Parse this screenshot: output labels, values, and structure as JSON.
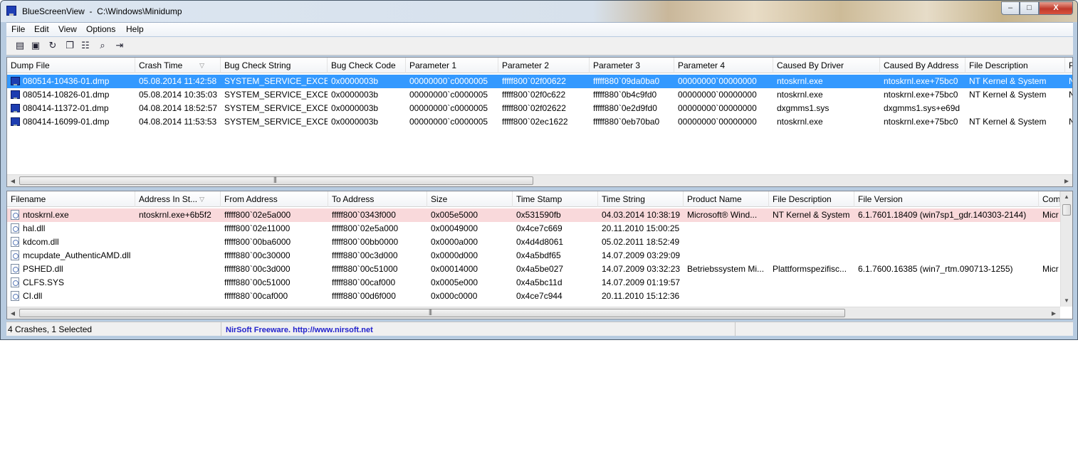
{
  "window": {
    "title": "BlueScreenView  -  C:\\Windows\\Minidump"
  },
  "titlebar_buttons": {
    "minimize": "–",
    "maximize": "□",
    "close": "X"
  },
  "menu": [
    "File",
    "Edit",
    "View",
    "Options",
    "Help"
  ],
  "toolbar": [
    {
      "icon": "properties-icon",
      "glyph": "▤"
    },
    {
      "icon": "save-icon",
      "glyph": "▣"
    },
    {
      "icon": "refresh-icon",
      "glyph": "↻"
    },
    {
      "icon": "copy-icon",
      "glyph": "❐"
    },
    {
      "icon": "report-icon",
      "glyph": "☷"
    },
    {
      "icon": "find-icon",
      "glyph": "⌕"
    },
    {
      "icon": "exit-icon",
      "glyph": "⇥"
    }
  ],
  "dumps": {
    "columns": [
      "Dump File",
      "Crash Time",
      "Bug Check String",
      "Bug Check Code",
      "Parameter 1",
      "Parameter 2",
      "Parameter 3",
      "Parameter 4",
      "Caused By Driver",
      "Caused By Address",
      "File Description",
      "P"
    ],
    "sorted_column": "Crash Time",
    "rows": [
      [
        "080514-10436-01.dmp",
        "05.08.2014 11:42:58",
        "SYSTEM_SERVICE_EXCE...",
        "0x0000003b",
        "00000000`c0000005",
        "fffff800`02f00622",
        "fffff880`09da0ba0",
        "00000000`00000000",
        "ntoskrnl.exe",
        "ntoskrnl.exe+75bc0",
        "NT Kernel & System",
        "N"
      ],
      [
        "080514-10826-01.dmp",
        "05.08.2014 10:35:03",
        "SYSTEM_SERVICE_EXCE...",
        "0x0000003b",
        "00000000`c0000005",
        "fffff800`02f0c622",
        "fffff880`0b4c9fd0",
        "00000000`00000000",
        "ntoskrnl.exe",
        "ntoskrnl.exe+75bc0",
        "NT Kernel & System",
        "N"
      ],
      [
        "080414-11372-01.dmp",
        "04.08.2014 18:52:57",
        "SYSTEM_SERVICE_EXCE...",
        "0x0000003b",
        "00000000`c0000005",
        "fffff800`02f02622",
        "fffff880`0e2d9fd0",
        "00000000`00000000",
        "dxgmms1.sys",
        "dxgmms1.sys+e69d",
        "",
        ""
      ],
      [
        "080414-16099-01.dmp",
        "04.08.2014 11:53:53",
        "SYSTEM_SERVICE_EXCE...",
        "0x0000003b",
        "00000000`c0000005",
        "fffff800`02ec1622",
        "fffff880`0eb70ba0",
        "00000000`00000000",
        "ntoskrnl.exe",
        "ntoskrnl.exe+75bc0",
        "NT Kernel & System",
        "N"
      ]
    ],
    "selected_index": 0
  },
  "modules": {
    "columns": [
      "Filename",
      "Address In St...",
      "From Address",
      "To Address",
      "Size",
      "Time Stamp",
      "Time String",
      "Product Name",
      "File Description",
      "File Version",
      "Com"
    ],
    "sorted_column": "Address In St...",
    "rows": [
      [
        "ntoskrnl.exe",
        "ntoskrnl.exe+6b5f2",
        "fffff800`02e5a000",
        "fffff800`0343f000",
        "0x005e5000",
        "0x531590fb",
        "04.03.2014 10:38:19",
        "Microsoft® Wind...",
        "NT Kernel & System",
        "6.1.7601.18409 (win7sp1_gdr.140303-2144)",
        "Micr"
      ],
      [
        "hal.dll",
        "",
        "fffff800`02e11000",
        "fffff800`02e5a000",
        "0x00049000",
        "0x4ce7c669",
        "20.11.2010 15:00:25",
        "",
        "",
        "",
        ""
      ],
      [
        "kdcom.dll",
        "",
        "fffff800`00ba6000",
        "fffff800`00bb0000",
        "0x0000a000",
        "0x4d4d8061",
        "05.02.2011 18:52:49",
        "",
        "",
        "",
        ""
      ],
      [
        "mcupdate_AuthenticAMD.dll",
        "",
        "fffff880`00c30000",
        "fffff880`00c3d000",
        "0x0000d000",
        "0x4a5bdf65",
        "14.07.2009 03:29:09",
        "",
        "",
        "",
        ""
      ],
      [
        "PSHED.dll",
        "",
        "fffff880`00c3d000",
        "fffff880`00c51000",
        "0x00014000",
        "0x4a5be027",
        "14.07.2009 03:32:23",
        "Betriebssystem Mi...",
        "Plattformspezifisc...",
        "6.1.7600.16385 (win7_rtm.090713-1255)",
        "Micr"
      ],
      [
        "CLFS.SYS",
        "",
        "fffff880`00c51000",
        "fffff880`00caf000",
        "0x0005e000",
        "0x4a5bc11d",
        "14.07.2009 01:19:57",
        "",
        "",
        "",
        ""
      ],
      [
        "CI.dll",
        "",
        "fffff880`00caf000",
        "fffff880`00d6f000",
        "0x000c0000",
        "0x4ce7c944",
        "20.11.2010 15:12:36",
        "",
        "",
        "",
        ""
      ]
    ],
    "highlighted_index": 0
  },
  "status": {
    "count_text": "4 Crashes, 1 Selected",
    "nirsoft": "NirSoft Freeware.  http://www.nirsoft.net"
  },
  "colors": {
    "selection": "#3399ff",
    "highlight_row": "#f9d9db",
    "link": "#2222cc"
  }
}
